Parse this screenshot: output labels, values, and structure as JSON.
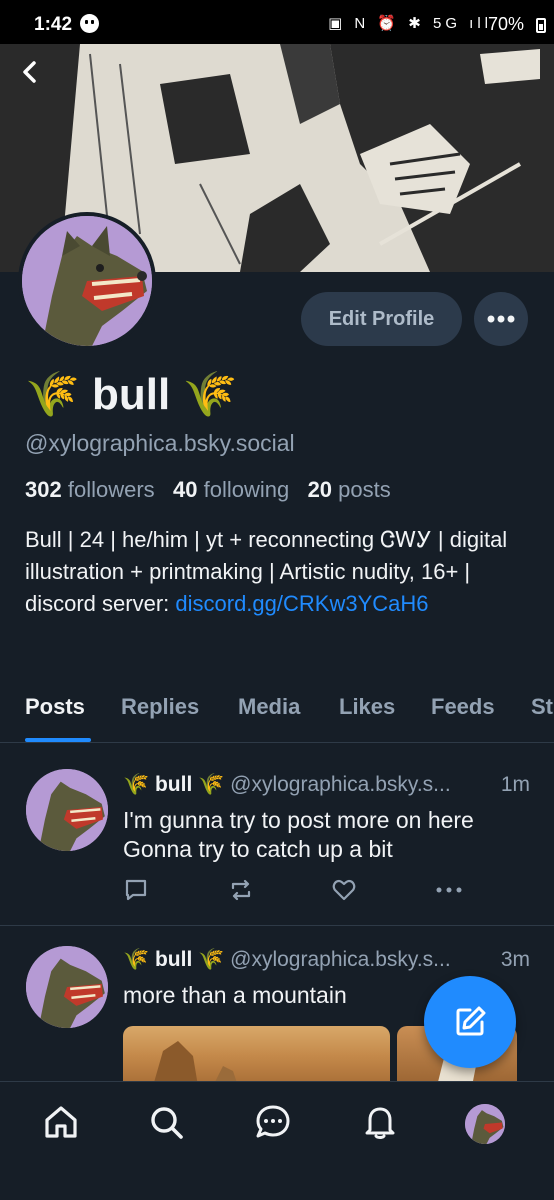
{
  "status_bar": {
    "time": "1:42",
    "icons": "▣ N ⏰ ✱ 5G ıll",
    "battery": "70%"
  },
  "profile": {
    "display_name": "🌾 bull 🌾",
    "handle": "@xylographica.bsky.social",
    "followers_count": "302",
    "followers_label": "followers",
    "following_count": "40",
    "following_label": "following",
    "posts_count": "20",
    "posts_label": "posts",
    "bio_text": "Bull | 24 | he/him | yt + reconnecting ᏣᎳᎩ | digital illustration + printmaking | Artistic nudity, 16+ | discord server: ",
    "bio_link": "discord.gg/CRKw3YCaH6",
    "edit_button": "Edit Profile"
  },
  "tabs": [
    {
      "label": "Posts",
      "active": true
    },
    {
      "label": "Replies",
      "active": false
    },
    {
      "label": "Media",
      "active": false
    },
    {
      "label": "Likes",
      "active": false
    },
    {
      "label": "Feeds",
      "active": false
    },
    {
      "label": "St",
      "active": false
    }
  ],
  "posts": [
    {
      "name": "🌾 bull 🌾",
      "handle": "@xylographica.bsky.s...",
      "time": "1m",
      "text_line1": "I'm gunna try to post more on here",
      "text_line2": "Gonna try to catch up a bit"
    },
    {
      "name": "🌾 bull 🌾",
      "handle": "@xylographica.bsky.s...",
      "time": "3m",
      "text_line1": "more than a mountain"
    }
  ],
  "colors": {
    "background": "#161e27",
    "accent": "#208bfe",
    "muted_text": "#93a2b3",
    "button_bg": "#2c3a4b"
  },
  "icons": {
    "back": "chevron-left-icon",
    "more": "ellipsis-icon",
    "compose": "compose-icon",
    "nav": [
      "home-icon",
      "search-icon",
      "chat-icon",
      "bell-icon",
      "profile-avatar"
    ]
  }
}
